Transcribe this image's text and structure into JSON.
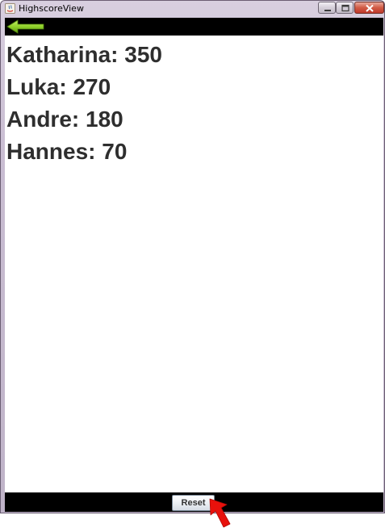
{
  "window": {
    "title": "HighscoreView"
  },
  "toolbar": {
    "back_icon": "back-arrow-icon",
    "back_color": "#8fd12a"
  },
  "scores": [
    {
      "name": "Katharina",
      "points": 350,
      "text": "Katharina: 350"
    },
    {
      "name": "Luka",
      "points": 270,
      "text": "Luka: 270"
    },
    {
      "name": "Andre",
      "points": 180,
      "text": "Andre: 180"
    },
    {
      "name": "Hannes",
      "points": 70,
      "text": "Hannes: 70"
    }
  ],
  "footer": {
    "reset_label": "Reset"
  },
  "annotation": {
    "icon": "red-pointer-arrow",
    "color": "#e8110c"
  }
}
